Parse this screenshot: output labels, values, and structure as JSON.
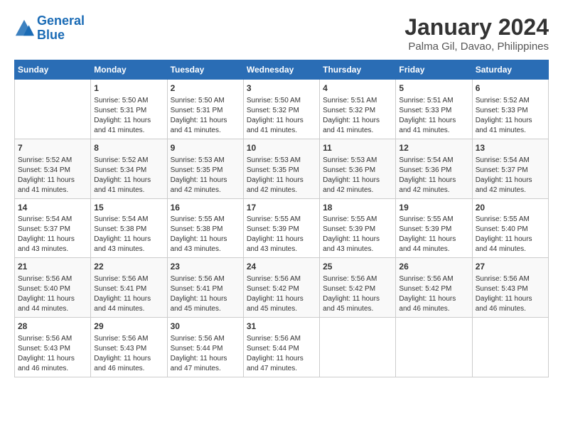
{
  "header": {
    "logo_line1": "General",
    "logo_line2": "Blue",
    "title": "January 2024",
    "subtitle": "Palma Gil, Davao, Philippines"
  },
  "calendar": {
    "weekdays": [
      "Sunday",
      "Monday",
      "Tuesday",
      "Wednesday",
      "Thursday",
      "Friday",
      "Saturday"
    ],
    "weeks": [
      [
        {
          "num": "",
          "sunrise": "",
          "sunset": "",
          "daylight": ""
        },
        {
          "num": "1",
          "sunrise": "Sunrise: 5:50 AM",
          "sunset": "Sunset: 5:31 PM",
          "daylight": "Daylight: 11 hours and 41 minutes."
        },
        {
          "num": "2",
          "sunrise": "Sunrise: 5:50 AM",
          "sunset": "Sunset: 5:31 PM",
          "daylight": "Daylight: 11 hours and 41 minutes."
        },
        {
          "num": "3",
          "sunrise": "Sunrise: 5:50 AM",
          "sunset": "Sunset: 5:32 PM",
          "daylight": "Daylight: 11 hours and 41 minutes."
        },
        {
          "num": "4",
          "sunrise": "Sunrise: 5:51 AM",
          "sunset": "Sunset: 5:32 PM",
          "daylight": "Daylight: 11 hours and 41 minutes."
        },
        {
          "num": "5",
          "sunrise": "Sunrise: 5:51 AM",
          "sunset": "Sunset: 5:33 PM",
          "daylight": "Daylight: 11 hours and 41 minutes."
        },
        {
          "num": "6",
          "sunrise": "Sunrise: 5:52 AM",
          "sunset": "Sunset: 5:33 PM",
          "daylight": "Daylight: 11 hours and 41 minutes."
        }
      ],
      [
        {
          "num": "7",
          "sunrise": "Sunrise: 5:52 AM",
          "sunset": "Sunset: 5:34 PM",
          "daylight": "Daylight: 11 hours and 41 minutes."
        },
        {
          "num": "8",
          "sunrise": "Sunrise: 5:52 AM",
          "sunset": "Sunset: 5:34 PM",
          "daylight": "Daylight: 11 hours and 41 minutes."
        },
        {
          "num": "9",
          "sunrise": "Sunrise: 5:53 AM",
          "sunset": "Sunset: 5:35 PM",
          "daylight": "Daylight: 11 hours and 42 minutes."
        },
        {
          "num": "10",
          "sunrise": "Sunrise: 5:53 AM",
          "sunset": "Sunset: 5:35 PM",
          "daylight": "Daylight: 11 hours and 42 minutes."
        },
        {
          "num": "11",
          "sunrise": "Sunrise: 5:53 AM",
          "sunset": "Sunset: 5:36 PM",
          "daylight": "Daylight: 11 hours and 42 minutes."
        },
        {
          "num": "12",
          "sunrise": "Sunrise: 5:54 AM",
          "sunset": "Sunset: 5:36 PM",
          "daylight": "Daylight: 11 hours and 42 minutes."
        },
        {
          "num": "13",
          "sunrise": "Sunrise: 5:54 AM",
          "sunset": "Sunset: 5:37 PM",
          "daylight": "Daylight: 11 hours and 42 minutes."
        }
      ],
      [
        {
          "num": "14",
          "sunrise": "Sunrise: 5:54 AM",
          "sunset": "Sunset: 5:37 PM",
          "daylight": "Daylight: 11 hours and 43 minutes."
        },
        {
          "num": "15",
          "sunrise": "Sunrise: 5:54 AM",
          "sunset": "Sunset: 5:38 PM",
          "daylight": "Daylight: 11 hours and 43 minutes."
        },
        {
          "num": "16",
          "sunrise": "Sunrise: 5:55 AM",
          "sunset": "Sunset: 5:38 PM",
          "daylight": "Daylight: 11 hours and 43 minutes."
        },
        {
          "num": "17",
          "sunrise": "Sunrise: 5:55 AM",
          "sunset": "Sunset: 5:39 PM",
          "daylight": "Daylight: 11 hours and 43 minutes."
        },
        {
          "num": "18",
          "sunrise": "Sunrise: 5:55 AM",
          "sunset": "Sunset: 5:39 PM",
          "daylight": "Daylight: 11 hours and 43 minutes."
        },
        {
          "num": "19",
          "sunrise": "Sunrise: 5:55 AM",
          "sunset": "Sunset: 5:39 PM",
          "daylight": "Daylight: 11 hours and 44 minutes."
        },
        {
          "num": "20",
          "sunrise": "Sunrise: 5:55 AM",
          "sunset": "Sunset: 5:40 PM",
          "daylight": "Daylight: 11 hours and 44 minutes."
        }
      ],
      [
        {
          "num": "21",
          "sunrise": "Sunrise: 5:56 AM",
          "sunset": "Sunset: 5:40 PM",
          "daylight": "Daylight: 11 hours and 44 minutes."
        },
        {
          "num": "22",
          "sunrise": "Sunrise: 5:56 AM",
          "sunset": "Sunset: 5:41 PM",
          "daylight": "Daylight: 11 hours and 44 minutes."
        },
        {
          "num": "23",
          "sunrise": "Sunrise: 5:56 AM",
          "sunset": "Sunset: 5:41 PM",
          "daylight": "Daylight: 11 hours and 45 minutes."
        },
        {
          "num": "24",
          "sunrise": "Sunrise: 5:56 AM",
          "sunset": "Sunset: 5:42 PM",
          "daylight": "Daylight: 11 hours and 45 minutes."
        },
        {
          "num": "25",
          "sunrise": "Sunrise: 5:56 AM",
          "sunset": "Sunset: 5:42 PM",
          "daylight": "Daylight: 11 hours and 45 minutes."
        },
        {
          "num": "26",
          "sunrise": "Sunrise: 5:56 AM",
          "sunset": "Sunset: 5:42 PM",
          "daylight": "Daylight: 11 hours and 46 minutes."
        },
        {
          "num": "27",
          "sunrise": "Sunrise: 5:56 AM",
          "sunset": "Sunset: 5:43 PM",
          "daylight": "Daylight: 11 hours and 46 minutes."
        }
      ],
      [
        {
          "num": "28",
          "sunrise": "Sunrise: 5:56 AM",
          "sunset": "Sunset: 5:43 PM",
          "daylight": "Daylight: 11 hours and 46 minutes."
        },
        {
          "num": "29",
          "sunrise": "Sunrise: 5:56 AM",
          "sunset": "Sunset: 5:43 PM",
          "daylight": "Daylight: 11 hours and 46 minutes."
        },
        {
          "num": "30",
          "sunrise": "Sunrise: 5:56 AM",
          "sunset": "Sunset: 5:44 PM",
          "daylight": "Daylight: 11 hours and 47 minutes."
        },
        {
          "num": "31",
          "sunrise": "Sunrise: 5:56 AM",
          "sunset": "Sunset: 5:44 PM",
          "daylight": "Daylight: 11 hours and 47 minutes."
        },
        {
          "num": "",
          "sunrise": "",
          "sunset": "",
          "daylight": ""
        },
        {
          "num": "",
          "sunrise": "",
          "sunset": "",
          "daylight": ""
        },
        {
          "num": "",
          "sunrise": "",
          "sunset": "",
          "daylight": ""
        }
      ]
    ]
  }
}
